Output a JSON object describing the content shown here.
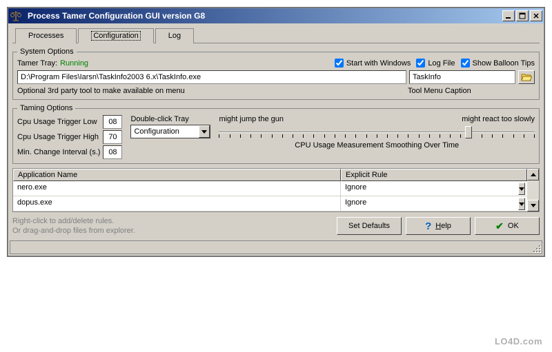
{
  "title": "Process Tamer Configuration GUI version G8",
  "tabs": {
    "processes": "Processes",
    "configuration": "Configuration",
    "log": "Log"
  },
  "system_options": {
    "legend": "System Options",
    "tray_label": "Tamer Tray:",
    "tray_status": "Running",
    "start_windows": "Start with Windows",
    "log_file": "Log File",
    "balloon_tips": "Show Balloon Tips",
    "tool_path": "D:\\Program Files\\Iarsn\\TaskInfo2003 6.x\\TaskInfo.exe",
    "tool_caption": "TaskInfo",
    "tool_path_hint": "Optional 3rd party tool to make available on menu",
    "tool_caption_hint": "Tool Menu Caption"
  },
  "taming_options": {
    "legend": "Taming Options",
    "trigger_low_label": "Cpu Usage Trigger Low",
    "trigger_low": "08",
    "trigger_high_label": "Cpu Usage Trigger High",
    "trigger_high": "70",
    "min_change_label": "Min. Change Interval (s.)",
    "min_change": "08",
    "dbl_click_label": "Double-click Tray",
    "dbl_click_value": "Configuration",
    "slider_left": "might jump the gun",
    "slider_right": "might react too slowly",
    "slider_caption": "CPU Usage Measurement Smoothing Over Time"
  },
  "rules": {
    "headers": {
      "app": "Application Name",
      "rule": "Explicit Rule"
    },
    "rows": [
      {
        "app": "nero.exe",
        "rule": "Ignore"
      },
      {
        "app": "dopus.exe",
        "rule": "Ignore"
      }
    ]
  },
  "hint": {
    "line1": "Right-click to add/delete rules.",
    "line2": "Or drag-and-drop files from explorer."
  },
  "buttons": {
    "defaults": "Set Defaults",
    "help": "elp",
    "help_u": "H",
    "ok": "OK"
  },
  "watermark": "LO4D.com"
}
